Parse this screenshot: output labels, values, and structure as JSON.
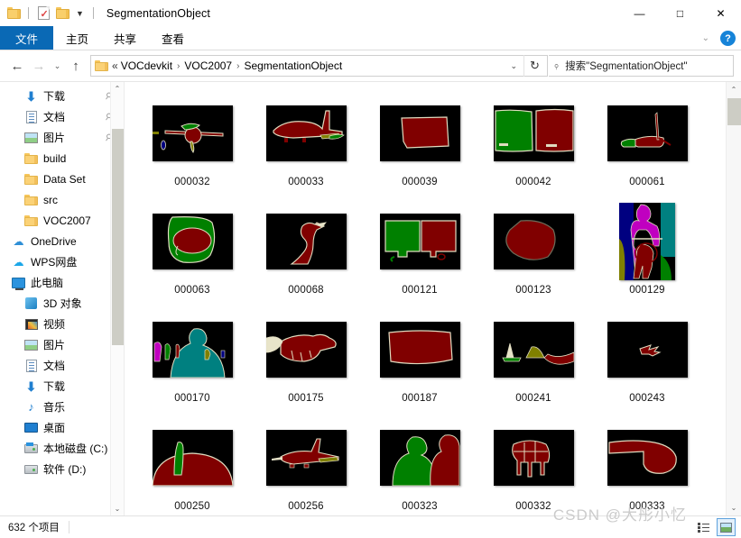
{
  "window": {
    "title": "SegmentationObject",
    "quick_access": [
      {
        "name": "folder-icon",
        "label": ""
      },
      {
        "name": "properties-icon",
        "label": ""
      },
      {
        "name": "new-folder-icon",
        "label": ""
      },
      {
        "name": "customize-caret-icon",
        "label": "▾"
      }
    ],
    "controls": {
      "minimize": "—",
      "maximize": "□",
      "close": "✕"
    }
  },
  "ribbon": {
    "tabs": [
      {
        "label": "文件",
        "active": true
      },
      {
        "label": "主页",
        "active": false
      },
      {
        "label": "共享",
        "active": false
      },
      {
        "label": "查看",
        "active": false
      }
    ],
    "collapse_caret": "⌄",
    "help_label": "?",
    "accent_color": "#0a69b5"
  },
  "address_bar": {
    "back_icon": "←",
    "forward_icon": "→",
    "recent_caret": "⌄",
    "up_icon": "↑",
    "path_prefix": "«",
    "crumbs": [
      "VOCdevkit",
      "VOC2007",
      "SegmentationObject"
    ],
    "crumb_separator": "›",
    "dropdown_caret": "⌄",
    "refresh_icon": "↻",
    "search_icon": "⌕",
    "search_placeholder": "搜索\"SegmentationObject\""
  },
  "sidebar": {
    "items": [
      {
        "label": "下载",
        "icon": "download-icon",
        "level": 1,
        "pinned": true
      },
      {
        "label": "文档",
        "icon": "document-icon",
        "level": 1,
        "pinned": true
      },
      {
        "label": "图片",
        "icon": "pictures-icon",
        "level": 1,
        "pinned": true
      },
      {
        "label": "build",
        "icon": "folder-icon",
        "level": 1,
        "pinned": false
      },
      {
        "label": "Data Set",
        "icon": "folder-icon",
        "level": 1,
        "pinned": false
      },
      {
        "label": "src",
        "icon": "folder-icon",
        "level": 1,
        "pinned": false
      },
      {
        "label": "VOC2007",
        "icon": "folder-icon",
        "level": 1,
        "pinned": false
      },
      {
        "label": "OneDrive",
        "icon": "onedrive-icon",
        "level": 0,
        "pinned": false
      },
      {
        "label": "WPS网盘",
        "icon": "wps-cloud-icon",
        "level": 0,
        "pinned": false
      },
      {
        "label": "此电脑",
        "icon": "this-pc-icon",
        "level": 0,
        "pinned": false
      },
      {
        "label": "3D 对象",
        "icon": "3d-objects-icon",
        "level": 1,
        "pinned": false
      },
      {
        "label": "视频",
        "icon": "videos-icon",
        "level": 1,
        "pinned": false
      },
      {
        "label": "图片",
        "icon": "pictures-icon",
        "level": 1,
        "pinned": false
      },
      {
        "label": "文档",
        "icon": "document-icon",
        "level": 1,
        "pinned": false
      },
      {
        "label": "下载",
        "icon": "download-icon",
        "level": 1,
        "pinned": false
      },
      {
        "label": "音乐",
        "icon": "music-icon",
        "level": 1,
        "pinned": false
      },
      {
        "label": "桌面",
        "icon": "desktop-icon",
        "level": 1,
        "pinned": false
      },
      {
        "label": "本地磁盘 (C:)",
        "icon": "system-drive-icon",
        "level": 1,
        "pinned": false
      },
      {
        "label": "软件 (D:)",
        "icon": "drive-icon",
        "level": 1,
        "pinned": false
      }
    ],
    "scroll_up": "⌃",
    "scroll_down": "⌄"
  },
  "files": [
    {
      "label": "000032",
      "variant": "v000032"
    },
    {
      "label": "000033",
      "variant": "v000033"
    },
    {
      "label": "000039",
      "variant": "v000039"
    },
    {
      "label": "000042",
      "variant": "v000042"
    },
    {
      "label": "000061",
      "variant": "v000061"
    },
    {
      "label": "000063",
      "variant": "v000063"
    },
    {
      "label": "000068",
      "variant": "v000068"
    },
    {
      "label": "000121",
      "variant": "v000121"
    },
    {
      "label": "000123",
      "variant": "v000123"
    },
    {
      "label": "000129",
      "variant": "v000129"
    },
    {
      "label": "000170",
      "variant": "v000170"
    },
    {
      "label": "000175",
      "variant": "v000175"
    },
    {
      "label": "000187",
      "variant": "v000187"
    },
    {
      "label": "000241",
      "variant": "v000241"
    },
    {
      "label": "000243",
      "variant": "v000243"
    },
    {
      "label": "000250",
      "variant": "v000250"
    },
    {
      "label": "000256",
      "variant": "v000256"
    },
    {
      "label": "000323",
      "variant": "v000323"
    },
    {
      "label": "000332",
      "variant": "v000332"
    },
    {
      "label": "000333",
      "variant": "v000333"
    }
  ],
  "palette": {
    "background": "#000000",
    "maroon": "#800000",
    "green": "#008000",
    "teal": "#008080",
    "navy": "#000080",
    "magenta": "#c000c0",
    "olive": "#808000",
    "cream": "#e8e4c9",
    "outline": "#e0dcc0"
  },
  "content_scroll": {
    "up": "⌃",
    "down": "⌄"
  },
  "status": {
    "item_count": "632 个项目"
  },
  "view_modes": [
    {
      "name": "details-view",
      "label": "",
      "active": false
    },
    {
      "name": "large-icons-view",
      "label": "",
      "active": true
    }
  ],
  "watermark": "CSDN @大彤小忆"
}
